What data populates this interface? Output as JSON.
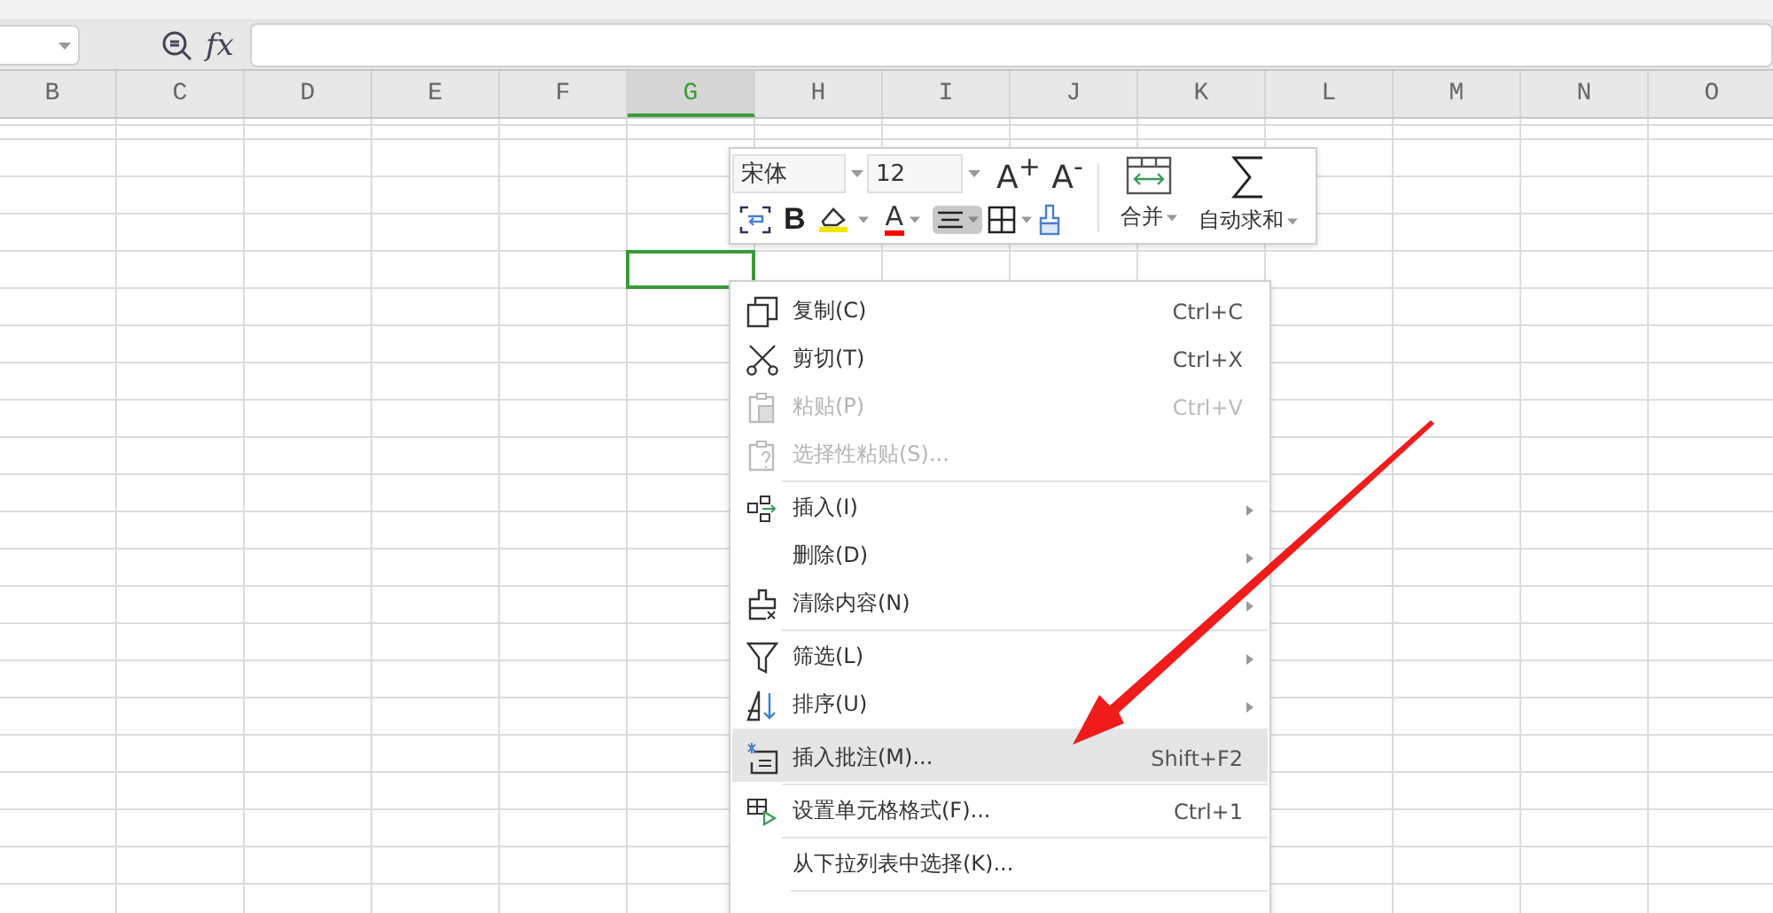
{
  "formula_bar": {
    "function_label": "fx"
  },
  "columns": [
    {
      "label": "B",
      "selected": false
    },
    {
      "label": "C",
      "selected": false
    },
    {
      "label": "D",
      "selected": false
    },
    {
      "label": "E",
      "selected": false
    },
    {
      "label": "F",
      "selected": false
    },
    {
      "label": "G",
      "selected": true
    },
    {
      "label": "H",
      "selected": false
    },
    {
      "label": "I",
      "selected": false
    },
    {
      "label": "J",
      "selected": false
    },
    {
      "label": "K",
      "selected": false
    },
    {
      "label": "L",
      "selected": false
    },
    {
      "label": "M",
      "selected": false
    },
    {
      "label": "N",
      "selected": false
    },
    {
      "label": "O",
      "selected": false
    }
  ],
  "mini_toolbar": {
    "font": "宋体",
    "size": "12",
    "grow_label": "A$^{+}$",
    "shrink_label": "A$^{-}$",
    "bold_label": "B",
    "font_color_label": "A",
    "alignment_pressed": true,
    "merge_label": "合并",
    "autosum_label": "自动求和"
  },
  "context_menu": {
    "trailing_separator": true,
    "items": [
      {
        "label": "复制(C)",
        "shortcut": "Ctrl+C",
        "disabled": false,
        "submenu": false,
        "selected": false,
        "separator_before": false
      },
      {
        "label": "剪切(T)",
        "shortcut": "Ctrl+X",
        "disabled": false,
        "submenu": false,
        "selected": false,
        "separator_before": false
      },
      {
        "label": "粘贴(P)",
        "shortcut": "Ctrl+V",
        "disabled": true,
        "submenu": false,
        "selected": false,
        "separator_before": false
      },
      {
        "label": "选择性粘贴(S)...",
        "disabled": true,
        "submenu": false,
        "selected": false,
        "separator_before": false
      },
      {
        "label": "插入(I)",
        "disabled": false,
        "submenu": true,
        "selected": false,
        "separator_before": true
      },
      {
        "label": "删除(D)",
        "disabled": false,
        "submenu": true,
        "selected": false,
        "separator_before": false
      },
      {
        "label": "清除内容(N)",
        "disabled": false,
        "submenu": true,
        "selected": false,
        "separator_before": false
      },
      {
        "label": "筛选(L)",
        "disabled": false,
        "submenu": true,
        "selected": false,
        "separator_before": true
      },
      {
        "label": "排序(U)",
        "disabled": false,
        "submenu": true,
        "selected": false,
        "separator_before": false
      },
      {
        "label": "插入批注(M)...",
        "shortcut": "Shift+F2",
        "disabled": false,
        "submenu": false,
        "selected": true,
        "separator_before": true
      },
      {
        "label": "设置单元格格式(F)...",
        "shortcut": "Ctrl+1",
        "disabled": false,
        "submenu": false,
        "selected": false,
        "separator_before": true
      },
      {
        "label": "从下拉列表中选择(K)...",
        "disabled": false,
        "submenu": false,
        "selected": false,
        "separator_before": true
      }
    ]
  }
}
